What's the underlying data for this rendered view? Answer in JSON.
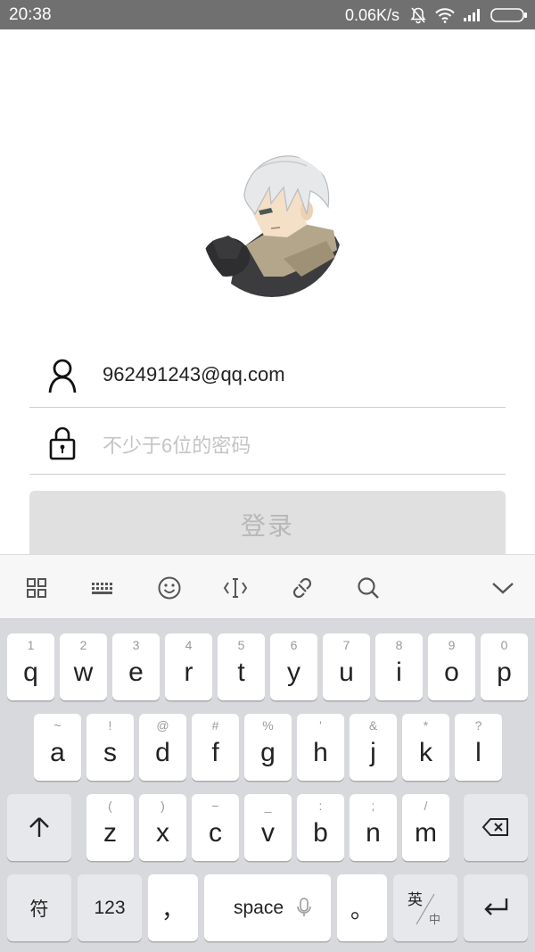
{
  "status_bar": {
    "time": "20:38",
    "net_speed": "0.06K/s",
    "icons": [
      "bell-muted-icon",
      "wifi-icon",
      "signal-icon",
      "battery-icon"
    ]
  },
  "avatar": {
    "description": "anime-avatar"
  },
  "form": {
    "username_value": "962491243@qq.com",
    "password_placeholder": "不少于6位的密码",
    "login_label": "登录"
  },
  "keyboard_toolbar": {
    "icons": [
      "grid-icon",
      "keyboard-icon",
      "emoji-icon",
      "cursor-icon",
      "link-icon",
      "search-icon",
      "collapse-chevron-icon"
    ]
  },
  "keyboard": {
    "row1": [
      {
        "hint": "1",
        "key": "q"
      },
      {
        "hint": "2",
        "key": "w"
      },
      {
        "hint": "3",
        "key": "e"
      },
      {
        "hint": "4",
        "key": "r"
      },
      {
        "hint": "5",
        "key": "t"
      },
      {
        "hint": "6",
        "key": "y"
      },
      {
        "hint": "7",
        "key": "u"
      },
      {
        "hint": "8",
        "key": "i"
      },
      {
        "hint": "9",
        "key": "o"
      },
      {
        "hint": "0",
        "key": "p"
      }
    ],
    "row2": [
      {
        "hint": "~",
        "key": "a"
      },
      {
        "hint": "!",
        "key": "s"
      },
      {
        "hint": "@",
        "key": "d"
      },
      {
        "hint": "#",
        "key": "f"
      },
      {
        "hint": "%",
        "key": "g"
      },
      {
        "hint": "'",
        "key": "h"
      },
      {
        "hint": "&",
        "key": "j"
      },
      {
        "hint": "*",
        "key": "k"
      },
      {
        "hint": "?",
        "key": "l"
      }
    ],
    "row3": [
      {
        "hint": "(",
        "key": "z"
      },
      {
        "hint": ")",
        "key": "x"
      },
      {
        "hint": "−",
        "key": "c"
      },
      {
        "hint": "_",
        "key": "v"
      },
      {
        "hint": ":",
        "key": "b"
      },
      {
        "hint": ";",
        "key": "n"
      },
      {
        "hint": "/",
        "key": "m"
      }
    ],
    "symbols_label": "符",
    "numbers_label": "123",
    "comma_label": "，",
    "space_label": "space",
    "period_label": "。",
    "lang_top": "英",
    "lang_bottom": "中"
  }
}
